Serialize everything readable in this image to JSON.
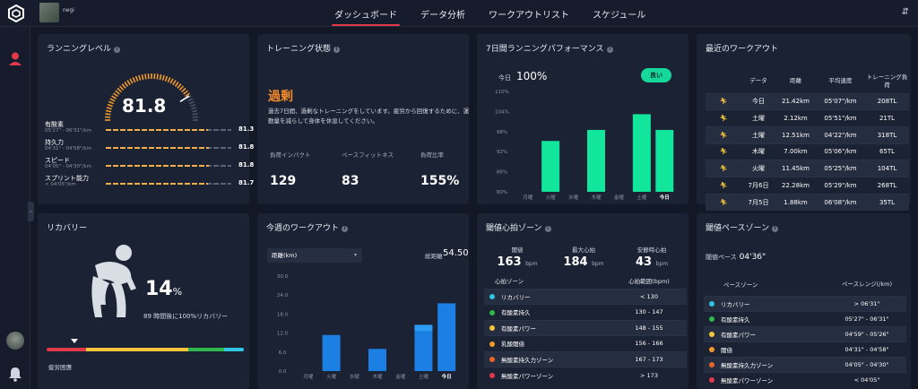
{
  "user": {
    "name": "negi"
  },
  "nav": {
    "tabs": [
      "ダッシュボード",
      "データ分析",
      "ワークアウトリスト",
      "スケジュール"
    ],
    "active": 0
  },
  "running_level": {
    "title": "ランニングレベル",
    "value": "81.8",
    "gauge_fraction": 0.818,
    "items": [
      {
        "name": "有酸素",
        "range": "05'27\" - 06'31\"/km",
        "value": "81.3",
        "fraction": 0.813
      },
      {
        "name": "持久力",
        "range": "04'31\" - 04'58\"/km",
        "value": "81.8",
        "fraction": 0.818
      },
      {
        "name": "スピード",
        "range": "04'05\" - 04'30\"/km",
        "value": "81.8",
        "fraction": 0.818
      },
      {
        "name": "スプリント能力",
        "range": "< 04'05\"/km",
        "value": "81.7",
        "fraction": 0.817
      }
    ]
  },
  "training_status": {
    "title": "トレーニング状態",
    "status": "過剰",
    "description": "過去7日間、過剰なトレーニングをしています。疲労から回復するために、運動量を減らして身体を休息してください。",
    "metrics": [
      {
        "label": "負荷インパクト",
        "value": "129"
      },
      {
        "label": "ペースフィットネス",
        "value": "83"
      },
      {
        "label": "負荷比率",
        "value": "155%"
      }
    ]
  },
  "performance": {
    "title": "7日間ランニングパフォーマンス",
    "today_label": "今日",
    "today_value": "100%",
    "badge": "良い",
    "chart_data": {
      "type": "bar",
      "categories": [
        "月曜",
        "火曜",
        "水曜",
        "木曜",
        "金曜",
        "土曜",
        "今日"
      ],
      "values": [
        null,
        95.2,
        null,
        98.5,
        null,
        103.2,
        98.5
      ],
      "ylim": [
        80,
        110
      ],
      "yticks": [
        "110%",
        "104%",
        "98%",
        "92%",
        "86%",
        "80%"
      ],
      "color": "#12e59c"
    }
  },
  "recent_workouts": {
    "title": "最近のワークアウト",
    "headers": [
      "データ",
      "距離",
      "平均速度",
      "トレーニング負荷"
    ],
    "rows": [
      [
        "今日",
        "21.42km",
        "05'07\"/km",
        "208TL"
      ],
      [
        "土曜",
        "2.12km",
        "05'51\"/km",
        "21TL"
      ],
      [
        "土曜",
        "12.51km",
        "04'22\"/km",
        "318TL"
      ],
      [
        "木曜",
        "7.00km",
        "05'06\"/km",
        "65TL"
      ],
      [
        "火曜",
        "11.45km",
        "05'25\"/km",
        "104TL"
      ],
      [
        "7月6日",
        "22.28km",
        "05'29\"/km",
        "268TL"
      ],
      [
        "7月5日",
        "1.88km",
        "06'08\"/km",
        "35TL"
      ]
    ]
  },
  "recovery": {
    "title": "リカバリー",
    "percent": "14",
    "percent_sign": "%",
    "subtitle": "89 時間後に100%リカバリー",
    "marker_fraction": 0.14,
    "status": "疲労困憊",
    "segments": [
      {
        "color": "#e23a4a",
        "fraction": 0.2
      },
      {
        "color": "#f6c53b",
        "fraction": 0.52
      },
      {
        "color": "#2fb84c",
        "fraction": 0.18
      },
      {
        "color": "#2fc7e3",
        "fraction": 0.1
      }
    ]
  },
  "weekly_workout": {
    "title": "今週のワークアウト",
    "select_value": "距離(km)",
    "total_label": "総距離",
    "total_value": "54.50",
    "chart_data": {
      "type": "bar",
      "categories": [
        "月曜",
        "火曜",
        "水曜",
        "木曜",
        "金曜",
        "土曜",
        "今日"
      ],
      "series": [
        {
          "values": [
            0,
            11.4,
            0,
            7.0,
            0,
            12.5,
            21.4
          ]
        },
        {
          "values": [
            0,
            0,
            0,
            0,
            0,
            2.1,
            0
          ]
        }
      ],
      "ylim": [
        0,
        30
      ],
      "yticks": [
        "30.0",
        "24.0",
        "18.0",
        "12.0",
        "6.0",
        "0.0"
      ],
      "colors": [
        "#1b7fe3",
        "#2a9cf5"
      ]
    }
  },
  "hr_zone": {
    "title": "閾値心拍ゾーン",
    "stats": [
      {
        "label": "閾値",
        "value": "163",
        "unit": "bpm"
      },
      {
        "label": "最大心拍",
        "value": "184",
        "unit": "bpm"
      },
      {
        "label": "安静時心拍",
        "value": "43",
        "unit": "bpm"
      }
    ],
    "headers": [
      "心拍ゾーン",
      "心拍範囲(bpm)"
    ],
    "rows": [
      {
        "name": "リカバリー",
        "range": "< 130",
        "color": "#2fc7e3"
      },
      {
        "name": "有酸素持久",
        "range": "130 - 147",
        "color": "#2fb84c"
      },
      {
        "name": "有酸素パワー",
        "range": "148 - 155",
        "color": "#f6c53b"
      },
      {
        "name": "乳酸閾値",
        "range": "156 - 166",
        "color": "#f39a2c"
      },
      {
        "name": "無酸素持久力ゾーン",
        "range": "167 - 173",
        "color": "#e8642c"
      },
      {
        "name": "無酸素パワーゾーン",
        "range": "> 173",
        "color": "#e23a4a"
      }
    ]
  },
  "pace_zone": {
    "title": "閾値ペースゾーン",
    "base_label": "閾値ペース",
    "base_value": "04'36\"",
    "headers": [
      "ペースゾーン",
      "ペースレンジ(/km)"
    ],
    "rows": [
      {
        "name": "リカバリー",
        "range": "> 06'31\"",
        "color": "#2fc7e3"
      },
      {
        "name": "有酸素持久",
        "range": "05'27\" - 06'31\"",
        "color": "#2fb84c"
      },
      {
        "name": "有酸素パワー",
        "range": "04'59\" - 05'26\"",
        "color": "#f6c53b"
      },
      {
        "name": "閾値",
        "range": "04'31\" - 04'58\"",
        "color": "#f39a2c"
      },
      {
        "name": "無酸素持久力ゾーン",
        "range": "04'05\" - 04'30\"",
        "color": "#e8642c"
      },
      {
        "name": "無酸素パワーゾーン",
        "range": "< 04'05\"",
        "color": "#e23a4a"
      }
    ]
  }
}
